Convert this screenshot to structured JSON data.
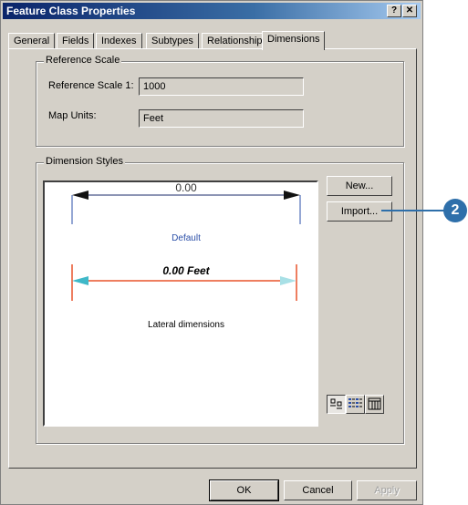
{
  "window": {
    "title": "Feature Class Properties",
    "help_label": "?",
    "close_label": "✕"
  },
  "tabs": [
    {
      "label": "General"
    },
    {
      "label": "Fields"
    },
    {
      "label": "Indexes"
    },
    {
      "label": "Subtypes"
    },
    {
      "label": "Relationships"
    },
    {
      "label": "Dimensions",
      "active": true
    }
  ],
  "reference_scale": {
    "group_title": "Reference Scale",
    "scale_label": "Reference Scale 1:",
    "scale_value": "1000",
    "units_label": "Map Units:",
    "units_value": "Feet"
  },
  "dimension_styles": {
    "group_title": "Dimension Styles",
    "new_label": "New...",
    "import_label": "Import...",
    "styles": [
      {
        "dimension_text": "0.00",
        "name": "Default"
      },
      {
        "dimension_text": "0.00 Feet",
        "name": "Lateral dimensions"
      }
    ],
    "view_buttons": [
      {
        "icon": "small-icons-view-icon",
        "pressed": true
      },
      {
        "icon": "list-view-icon",
        "pressed": false
      },
      {
        "icon": "details-view-icon",
        "pressed": false
      }
    ]
  },
  "footer": {
    "ok_label": "OK",
    "cancel_label": "Cancel",
    "apply_label": "Apply"
  },
  "callout": {
    "number": "2"
  },
  "colors": {
    "titlebar": "#0a246a",
    "callout": "#2e6faa",
    "lateral_line": "#e8532a",
    "lateral_arrow": "#3fb8c8",
    "default_text": "#2b4fa8"
  }
}
